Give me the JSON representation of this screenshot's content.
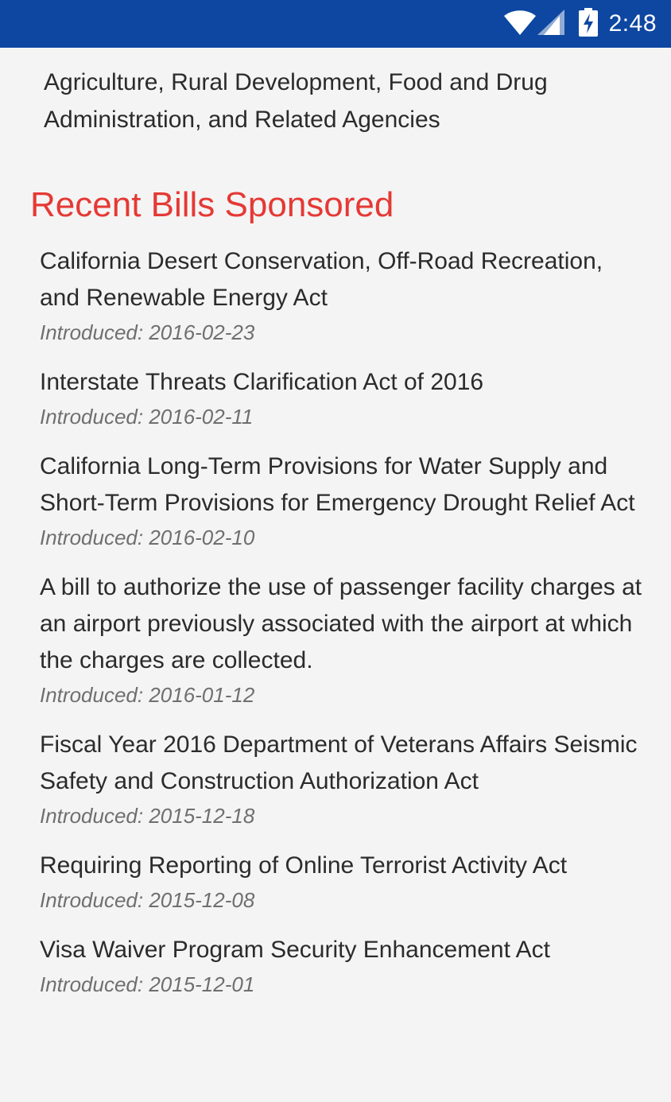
{
  "status_bar": {
    "time": "2:48",
    "background": "#0d47a1",
    "icons": [
      "wifi-icon",
      "cell-signal-icon",
      "battery-charging-icon"
    ]
  },
  "committee": {
    "text": "Agriculture, Rural Development, Food and Drug Administration, and Related Agencies"
  },
  "section": {
    "title": "Recent Bills Sponsored",
    "title_color": "#e53935"
  },
  "bills": [
    {
      "title": "California Desert Conservation, Off-Road Recreation, and Renewable Energy Act",
      "introduced": "Introduced: 2016-02-23"
    },
    {
      "title": "Interstate Threats Clarification Act of 2016",
      "introduced": "Introduced: 2016-02-11"
    },
    {
      "title": "California Long-Term Provisions for Water Supply and Short-Term Provisions for Emergency Drought Relief Act",
      "introduced": "Introduced: 2016-02-10"
    },
    {
      "title": "A bill to authorize the use of passenger facility charges at an airport previously associated with the airport at which the charges are collected.",
      "introduced": "Introduced: 2016-01-12"
    },
    {
      "title": "Fiscal Year 2016 Department of Veterans Affairs Seismic Safety and Construction Authorization Act",
      "introduced": "Introduced: 2015-12-18"
    },
    {
      "title": "Requiring Reporting of Online Terrorist Activity Act",
      "introduced": "Introduced: 2015-12-08"
    },
    {
      "title": "Visa Waiver Program Security Enhancement Act",
      "introduced": "Introduced: 2015-12-01"
    }
  ]
}
